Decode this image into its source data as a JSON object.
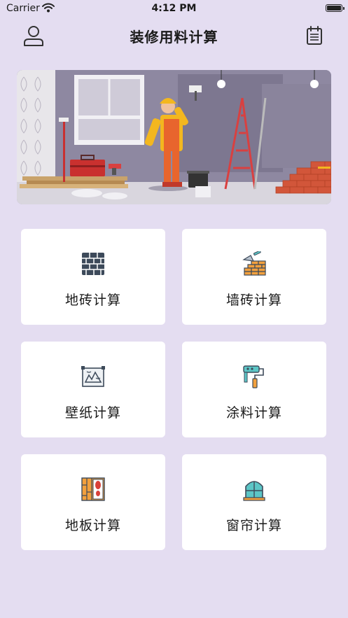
{
  "status_bar": {
    "carrier": "Carrier",
    "time": "4:12 PM"
  },
  "nav": {
    "title": "装修用料计算",
    "left_icon": "user-icon",
    "right_icon": "calendar-icon"
  },
  "banner": {
    "subject": "renovation-worker-illustration"
  },
  "menu": [
    {
      "label": "地砖计算",
      "icon": "floor-tile-icon"
    },
    {
      "label": "墙砖计算",
      "icon": "wall-brick-trowel-icon"
    },
    {
      "label": "壁纸计算",
      "icon": "wallpaper-frame-icon"
    },
    {
      "label": "涂料计算",
      "icon": "paint-roller-icon"
    },
    {
      "label": "地板计算",
      "icon": "wood-floor-icon"
    },
    {
      "label": "窗帘计算",
      "icon": "curtain-window-icon"
    }
  ],
  "colors": {
    "background": "#e4ddf1",
    "card": "#ffffff",
    "text": "#1a1a1a",
    "icon_dark": "#3d4a5a",
    "icon_orange": "#f2a03d",
    "icon_teal": "#5cc6c6"
  }
}
